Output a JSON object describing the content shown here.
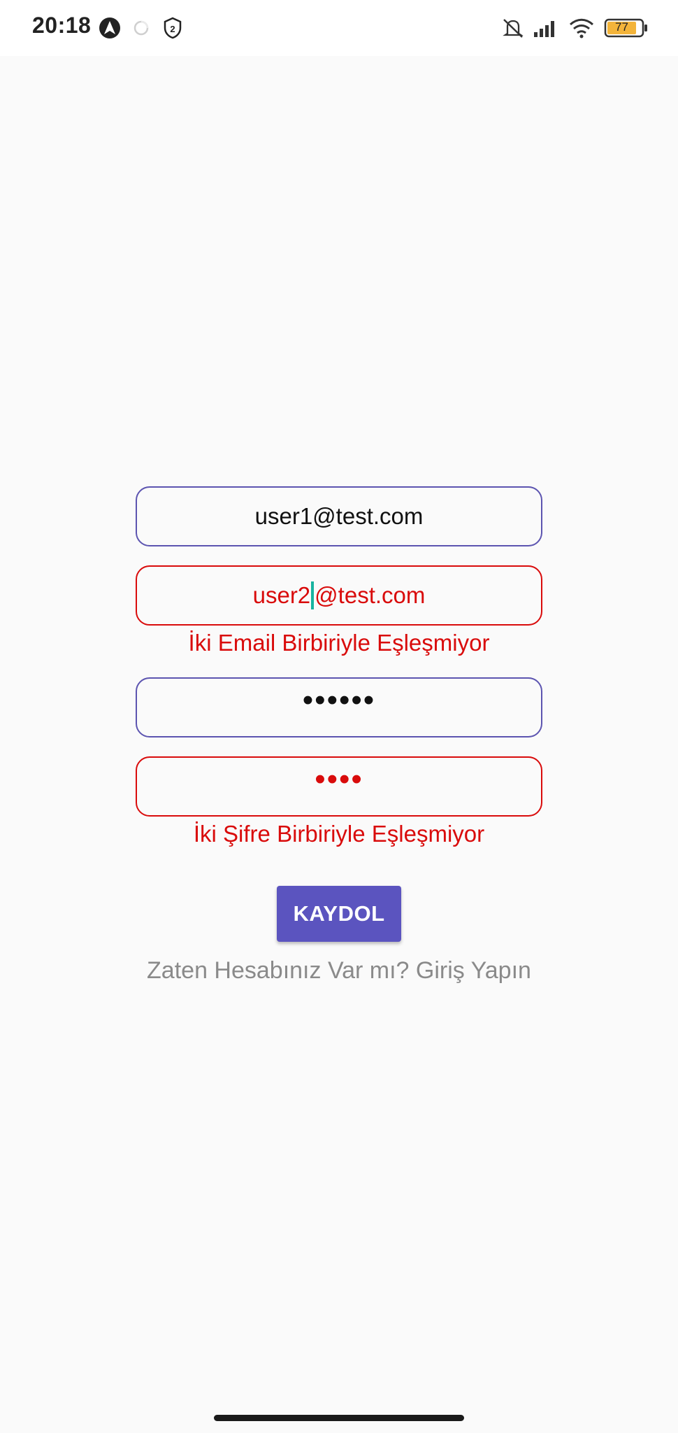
{
  "status_bar": {
    "time": "20:18",
    "battery": "77",
    "notification_badge": "2"
  },
  "form": {
    "email": "user1@test.com",
    "email_confirm_before_cursor": "user2",
    "email_confirm_after_cursor": "@test.com",
    "email_error": "İki Email Birbiriyle Eşleşmiyor",
    "password_mask": "••••••",
    "password_confirm_mask": "••••",
    "password_error": "İki Şifre Birbiriyle Eşleşmiyor"
  },
  "actions": {
    "register_label": "KAYDOL",
    "login_prompt": "Zaten Hesabınız Var mı? Giriş Yapın"
  },
  "colors": {
    "accent": "#5b54bf",
    "error": "#d90b0b",
    "cursor": "#18b3a0"
  }
}
